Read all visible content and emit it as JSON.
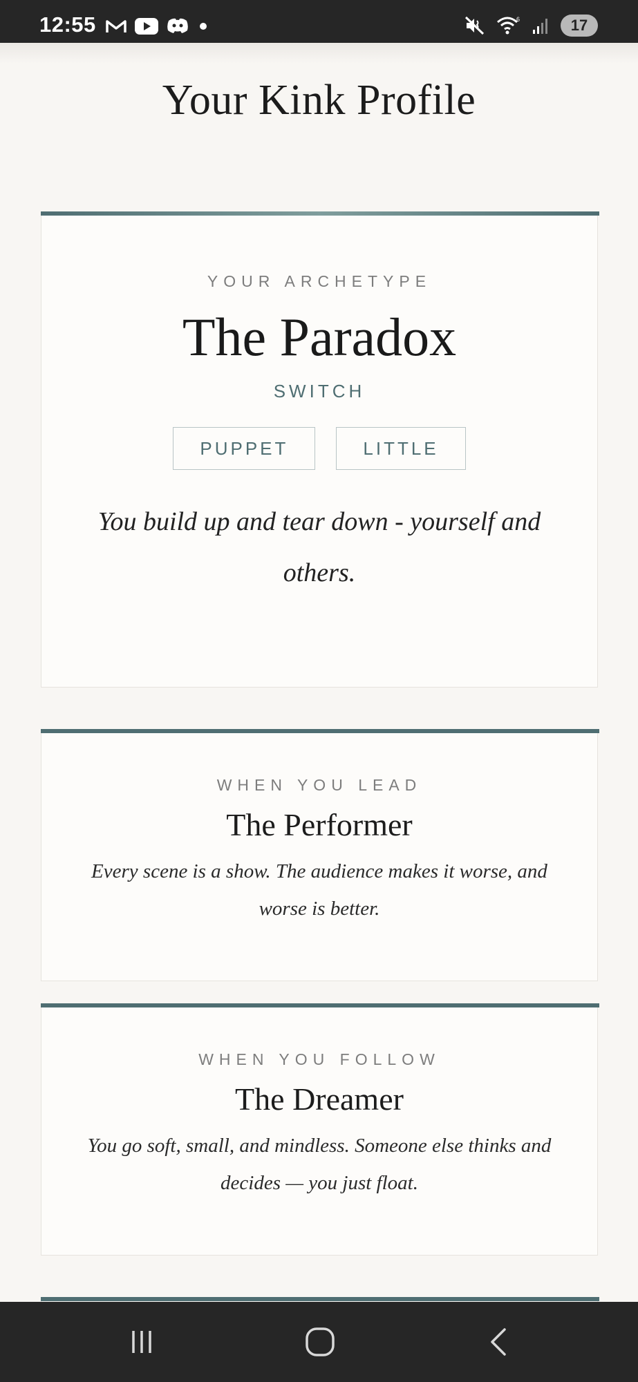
{
  "status_bar": {
    "time": "12:55",
    "left_icons": [
      "gmail-icon",
      "youtube-icon",
      "discord-icon",
      "dot-icon"
    ],
    "right_icons": [
      "mute-vibrate-icon",
      "wifi-icon",
      "signal-icon"
    ],
    "battery": "17"
  },
  "page": {
    "title": "Your Kink Profile"
  },
  "archetype_card": {
    "eyebrow": "YOUR ARCHETYPE",
    "name": "The Paradox",
    "subtype": "SWITCH",
    "tags": [
      "PUPPET",
      "LITTLE"
    ],
    "quote_line1": "You build up and tear down - yourself and",
    "quote_line2": "others."
  },
  "lead_card": {
    "eyebrow": "WHEN YOU LEAD",
    "name": "The Performer",
    "desc_line1": "Every scene is a show. The audience makes it worse, and",
    "desc_line2": "worse is better."
  },
  "follow_card": {
    "eyebrow": "WHEN YOU FOLLOW",
    "name": "The Dreamer",
    "desc_line1": "You go soft, small, and mindless. Someone else thinks and",
    "desc_line2": "decides — you just float."
  },
  "nav_bar": {
    "icons": [
      "recent-apps-icon",
      "home-icon",
      "back-icon"
    ]
  },
  "colors": {
    "accent": "#4f6e72",
    "background": "#f8f6f3",
    "card": "#fdfcfa",
    "system_bar": "#262626"
  }
}
